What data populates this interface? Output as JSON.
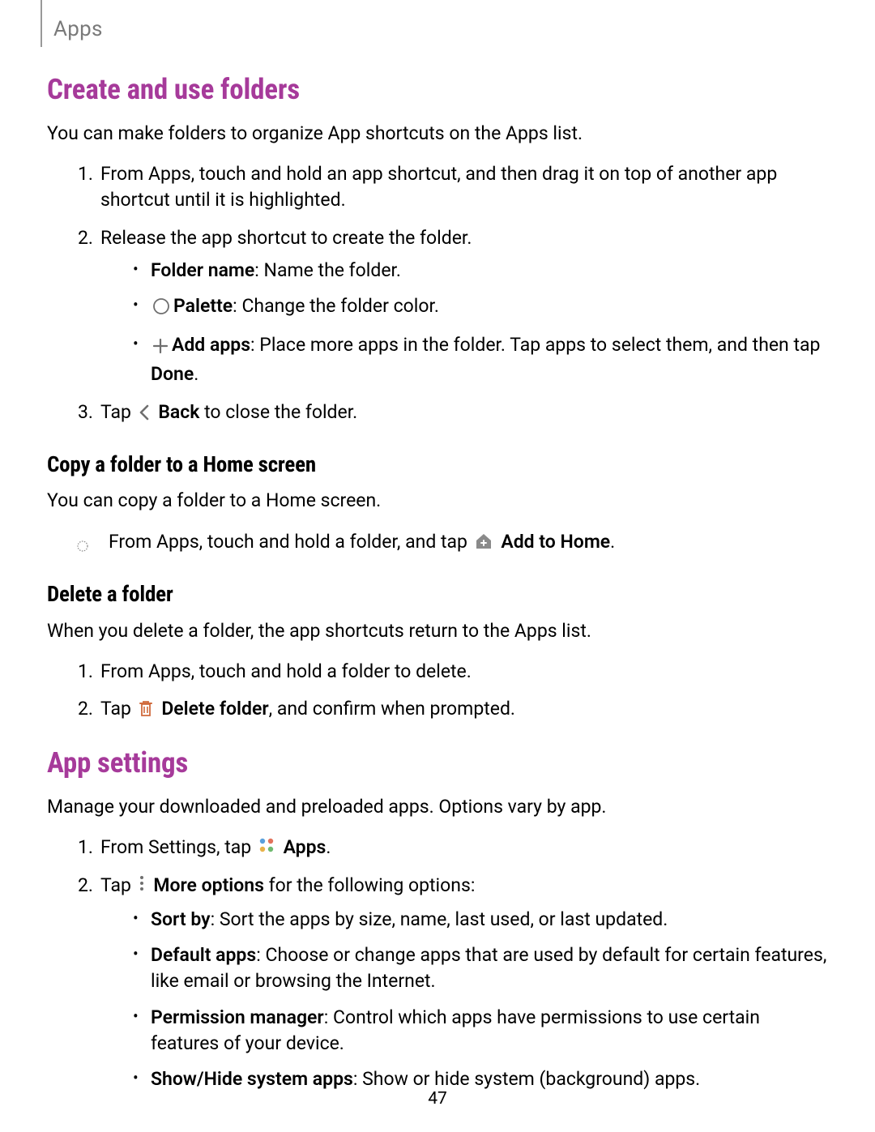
{
  "header": {
    "label": "Apps"
  },
  "section1": {
    "title": "Create and use folders",
    "intro": "You can make folders to organize App shortcuts on the Apps list.",
    "step1": "From Apps, touch and hold an app shortcut, and then drag it on top of another app shortcut until it is highlighted.",
    "step2": "Release the app shortcut to create the folder.",
    "step2_b1_label": "Folder name",
    "step2_b1_text": ": Name the folder.",
    "step2_b2_label": "Palette",
    "step2_b2_text": ": Change the folder color.",
    "step2_b3_label": "Add apps",
    "step2_b3_text1": ": Place more apps in the folder. Tap apps to select them, and then tap ",
    "step2_b3_done": "Done",
    "step2_b3_text2": ".",
    "step3_pre": "Tap ",
    "step3_label": "Back",
    "step3_post": " to close the folder."
  },
  "section2": {
    "title": "Copy a folder to a Home screen",
    "intro": "You can copy a folder to a Home screen.",
    "bullet_pre": "From Apps, touch and hold a folder, and tap ",
    "bullet_label": "Add to Home",
    "bullet_post": "."
  },
  "section3": {
    "title": "Delete a folder",
    "intro": "When you delete a folder, the app shortcuts return to the Apps list.",
    "step1": "From Apps, touch and hold a folder to delete.",
    "step2_pre": "Tap ",
    "step2_label": "Delete folder",
    "step2_post": ", and confirm when prompted."
  },
  "section4": {
    "title": "App settings",
    "intro": "Manage your downloaded and preloaded apps. Options vary by app.",
    "step1_pre": "From Settings, tap ",
    "step1_label": "Apps",
    "step1_post": ".",
    "step2_pre": "Tap ",
    "step2_label": "More options",
    "step2_post": " for the following options:",
    "b1_label": "Sort by",
    "b1_text": ": Sort the apps by size, name, last used, or last updated.",
    "b2_label": "Default apps",
    "b2_text": ": Choose or change apps that are used by default for certain features, like email or browsing the Internet.",
    "b3_label": "Permission manager",
    "b3_text": ": Control which apps have permissions to use certain features of your device.",
    "b4_label": "Show/Hide system apps",
    "b4_text": ": Show or hide system (background) apps."
  },
  "pageNumber": "47"
}
